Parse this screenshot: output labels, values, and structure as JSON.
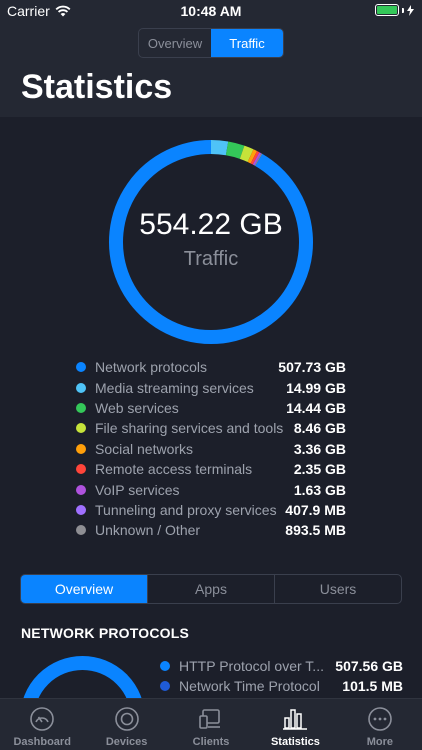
{
  "status_bar": {
    "carrier": "Carrier",
    "time": "10:48 AM"
  },
  "top_segment": {
    "items": [
      "Overview",
      "Traffic"
    ],
    "selected": "Traffic"
  },
  "page_title": "Statistics",
  "summary": {
    "value": "554.22 GB",
    "label": "Traffic"
  },
  "traffic_breakdown": [
    {
      "name": "Network protocols",
      "value": "507.73 GB",
      "color": "#0a84ff"
    },
    {
      "name": "Media streaming services",
      "value": "14.99 GB",
      "color": "#4fc3f7"
    },
    {
      "name": "Web services",
      "value": "14.44 GB",
      "color": "#34c759"
    },
    {
      "name": "File sharing services and tools",
      "value": "8.46 GB",
      "color": "#c6e33a"
    },
    {
      "name": "Social networks",
      "value": "3.36 GB",
      "color": "#ff9f0a"
    },
    {
      "name": "Remote access terminals",
      "value": "2.35 GB",
      "color": "#ff453a"
    },
    {
      "name": "VoIP services",
      "value": "1.63 GB",
      "color": "#af52de"
    },
    {
      "name": "Tunneling and proxy services",
      "value": "407.9 MB",
      "color": "#a070ff"
    },
    {
      "name": "Unknown / Other",
      "value": "893.5 MB",
      "color": "#8e8e93"
    }
  ],
  "mid_segment": {
    "items": [
      "Overview",
      "Apps",
      "Users"
    ],
    "selected": "Overview"
  },
  "section": {
    "title": "NETWORK PROTOCOLS"
  },
  "protocols": [
    {
      "name": "HTTP Protocol over T...",
      "value": "507.56 GB",
      "color": "#0a84ff"
    },
    {
      "name": "Network Time Protocol",
      "value": "101.5 MB",
      "color": "#1f5bd6"
    }
  ],
  "tabbar": {
    "items": [
      {
        "label": "Dashboard",
        "icon": "dashboard-gauge-icon"
      },
      {
        "label": "Devices",
        "icon": "devices-icon"
      },
      {
        "label": "Clients",
        "icon": "clients-icon"
      },
      {
        "label": "Statistics",
        "icon": "statistics-bar-chart-icon"
      },
      {
        "label": "More",
        "icon": "more-ellipsis-icon"
      }
    ],
    "selected": "Statistics"
  },
  "colors": {
    "background": "#1c1f2a",
    "header": "#242833",
    "accent": "#0a84ff",
    "muted_text": "#8b8f9a"
  }
}
